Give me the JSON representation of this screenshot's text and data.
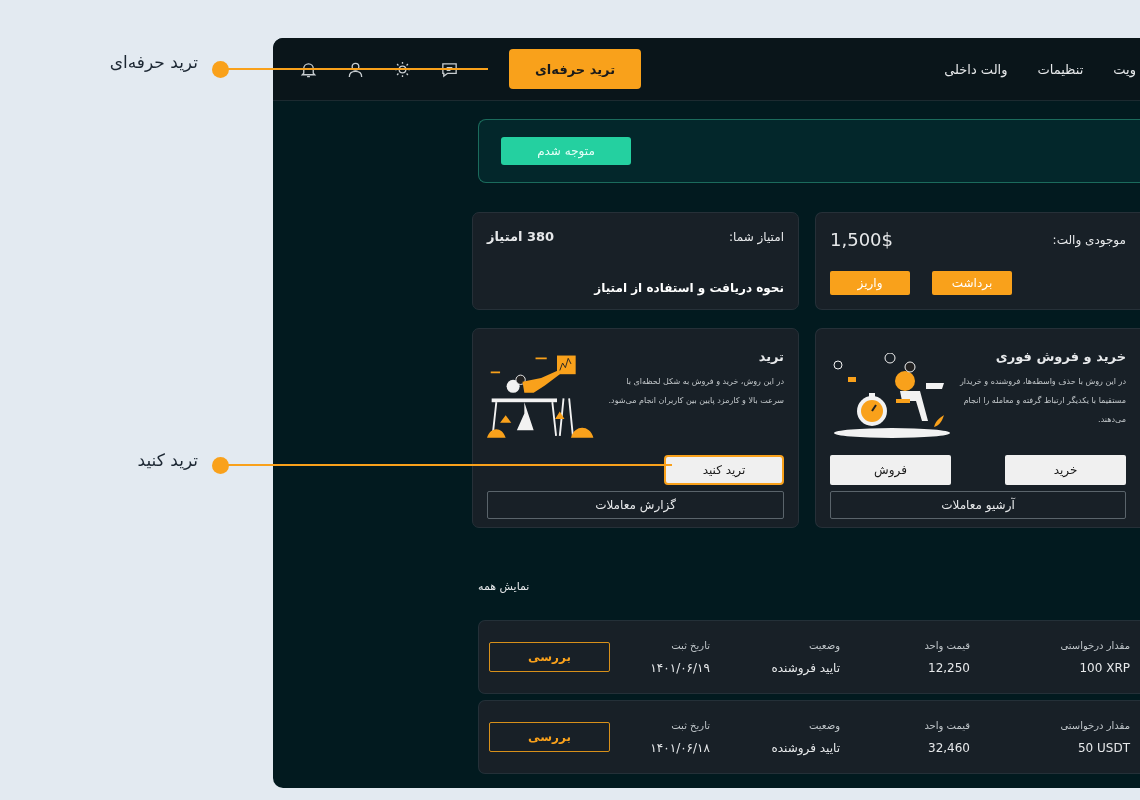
{
  "callouts": [
    {
      "label": "ترید حرفه‌ای"
    },
    {
      "label": "ترید کنید"
    }
  ],
  "header": {
    "nav": [
      "ویت",
      "تنظیمات",
      "والت داخلی"
    ],
    "pro_button": "ترید حرفه‌ای"
  },
  "notice": {
    "button": "متوجه شدم"
  },
  "wallet": {
    "label": "موجودی والت:",
    "balance": "1,500$",
    "buttons": [
      "برداشت",
      "واریز"
    ]
  },
  "points": {
    "label": "امتیاز شما:",
    "value": "380 امتیاز",
    "link": "نحوه دریافت و استفاده از امتیاز"
  },
  "instant": {
    "title": "خرید و فروش فوری",
    "description": "در این روش با حذف واسطه‌ها، فروشنده و خریدار مستقیما با یکدیگر ارتباط گرفته و معامله را انجام می‌دهند.",
    "buttons": [
      "خرید",
      "فروش"
    ],
    "archive": "آرشیو معاملات"
  },
  "trade": {
    "title": "ترید",
    "description": "در این روش، خرید و فروش به شکل لحظه‌ای با سرعت بالا و کارمزد پایین بین کاربران انجام می‌شود.",
    "button": "ترید کنید",
    "report": "گزارش معاملات"
  },
  "show_all": "نمایش همه",
  "orders": [
    {
      "fields": [
        {
          "label": "مقدار درخواستی",
          "value": "100 XRP"
        },
        {
          "label": "قیمت واحد",
          "value": "12,250"
        },
        {
          "label": "وضعیت",
          "value": "تایید فروشنده"
        },
        {
          "label": "تاریخ ثبت",
          "value": "۱۴۰۱/۰۶/۱۹"
        }
      ],
      "action": "بررسی"
    },
    {
      "fields": [
        {
          "label": "مقدار درخواستی",
          "value": "50 USDT"
        },
        {
          "label": "قیمت واحد",
          "value": "32,460"
        },
        {
          "label": "وضعیت",
          "value": "تایید فروشنده"
        },
        {
          "label": "تاریخ ثبت",
          "value": "۱۴۰۱/۰۶/۱۸"
        }
      ],
      "action": "بررسی"
    }
  ]
}
